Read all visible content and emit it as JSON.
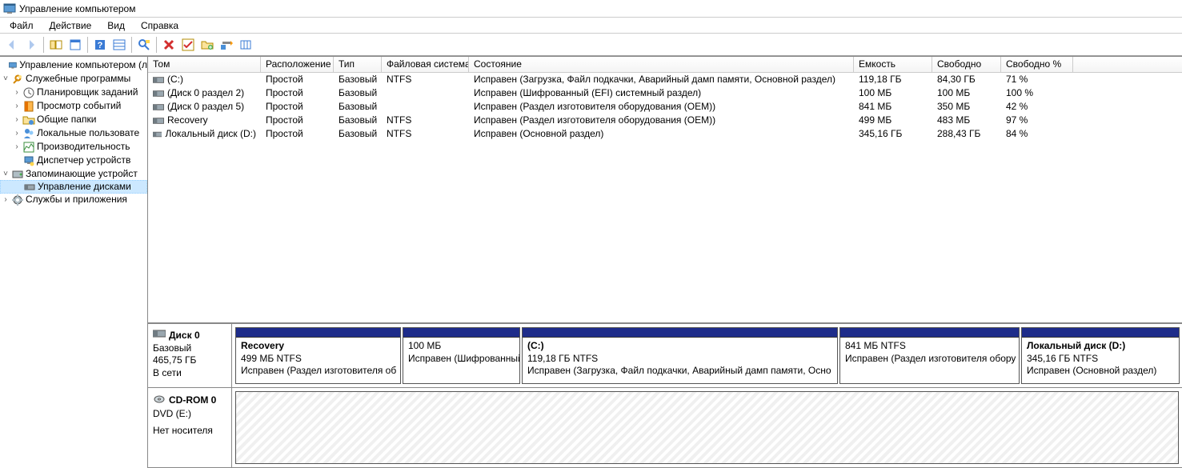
{
  "window": {
    "title": "Управление компьютером"
  },
  "menubar": {
    "file": "Файл",
    "action": "Действие",
    "view": "Вид",
    "help": "Справка"
  },
  "tree": {
    "root": "Управление компьютером (л",
    "systools": "Служебные программы",
    "scheduler": "Планировщик заданий",
    "eventvwr": "Просмотр событий",
    "sharedfolders": "Общие папки",
    "localusers": "Локальные пользовате",
    "perf": "Производительность",
    "devmgr": "Диспетчер устройств",
    "storage": "Запоминающие устройст",
    "diskmgmt": "Управление дисками",
    "services": "Службы и приложения"
  },
  "vol_headers": {
    "volume": "Том",
    "layout": "Расположение",
    "type": "Тип",
    "fs": "Файловая система",
    "status": "Состояние",
    "capacity": "Емкость",
    "free": "Свободно",
    "freep": "Свободно %"
  },
  "volumes": [
    {
      "name": "(C:)",
      "layout": "Простой",
      "type": "Базовый",
      "fs": "NTFS",
      "status": "Исправен (Загрузка, Файл подкачки, Аварийный дамп памяти, Основной раздел)",
      "cap": "119,18 ГБ",
      "free": "84,30 ГБ",
      "freep": "71 %"
    },
    {
      "name": "(Диск 0 раздел 2)",
      "layout": "Простой",
      "type": "Базовый",
      "fs": "",
      "status": "Исправен (Шифрованный (EFI) системный раздел)",
      "cap": "100 МБ",
      "free": "100 МБ",
      "freep": "100 %"
    },
    {
      "name": "(Диск 0 раздел 5)",
      "layout": "Простой",
      "type": "Базовый",
      "fs": "",
      "status": "Исправен (Раздел изготовителя оборудования (OEM))",
      "cap": "841 МБ",
      "free": "350 МБ",
      "freep": "42 %"
    },
    {
      "name": "Recovery",
      "layout": "Простой",
      "type": "Базовый",
      "fs": "NTFS",
      "status": "Исправен (Раздел изготовителя оборудования (OEM))",
      "cap": "499 МБ",
      "free": "483 МБ",
      "freep": "97 %"
    },
    {
      "name": "Локальный диск (D:)",
      "layout": "Простой",
      "type": "Базовый",
      "fs": "NTFS",
      "status": "Исправен (Основной раздел)",
      "cap": "345,16 ГБ",
      "free": "288,43 ГБ",
      "freep": "84 %"
    }
  ],
  "disk0": {
    "label": "Диск 0",
    "type": "Базовый",
    "size": "465,75 ГБ",
    "status": "В сети",
    "parts": [
      {
        "name": "Recovery",
        "size": "499 МБ NTFS",
        "status": "Исправен (Раздел изготовителя об"
      },
      {
        "name": "",
        "size": "100 МБ",
        "status": "Исправен (Шифрованный"
      },
      {
        "name": "(C:)",
        "size": "119,18 ГБ NTFS",
        "status": "Исправен (Загрузка, Файл подкачки, Аварийный дамп памяти, Осно"
      },
      {
        "name": "",
        "size": "841 МБ NTFS",
        "status": "Исправен (Раздел изготовителя обору"
      },
      {
        "name": "Локальный диск  (D:)",
        "size": "345,16 ГБ NTFS",
        "status": "Исправен (Основной раздел)"
      }
    ]
  },
  "cdrom": {
    "label": "CD-ROM 0",
    "drive": "DVD (E:)",
    "status": "Нет носителя"
  }
}
